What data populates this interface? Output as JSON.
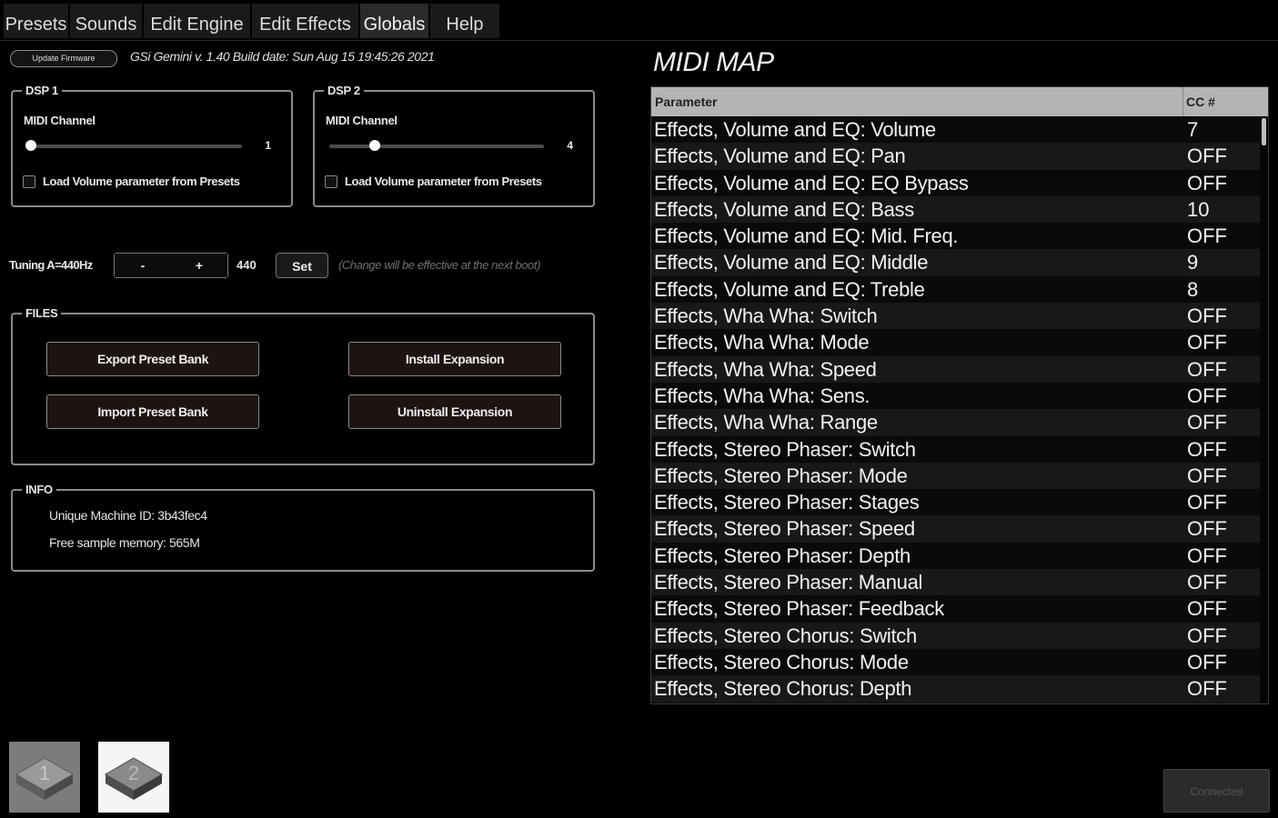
{
  "tabs": [
    {
      "label": "Presets",
      "active": false
    },
    {
      "label": "Sounds",
      "active": false
    },
    {
      "label": "Edit Engine",
      "active": false
    },
    {
      "label": "Edit Effects",
      "active": false
    },
    {
      "label": "Globals",
      "active": true
    },
    {
      "label": "Help",
      "active": false
    }
  ],
  "status": {
    "update_button": "Update Firmware",
    "build_info": "GSi Gemini v. 1.40 Build date: Sun Aug 15 19:45:26 2021"
  },
  "dsp1": {
    "title": "DSP 1",
    "midi_label": "MIDI Channel",
    "channel": "1",
    "channel_fraction": 0.0,
    "checkbox_label": "Load Volume parameter from Presets",
    "checked": false
  },
  "dsp2": {
    "title": "DSP 2",
    "midi_label": "MIDI Channel",
    "channel": "4",
    "channel_fraction": 0.2,
    "checkbox_label": "Load Volume parameter from Presets",
    "checked": false
  },
  "tuning": {
    "label": "Tuning A=440Hz",
    "minus": "-",
    "plus": "+",
    "value": "440",
    "set_label": "Set",
    "note": "(Change will be effective at the next boot)"
  },
  "files": {
    "title": "FILES",
    "export": "Export Preset Bank",
    "import": "Import Preset Bank",
    "install": "Install Expansion",
    "uninstall": "Uninstall Expansion"
  },
  "info": {
    "title": "INFO",
    "machine_id": "Unique Machine ID: 3b43fec4",
    "free_memory": "Free sample memory: 565M"
  },
  "midi_map": {
    "title": "MIDI MAP",
    "col_param": "Parameter",
    "col_cc": "CC #",
    "rows": [
      {
        "param": "Effects, Volume and EQ: Volume",
        "cc": "7"
      },
      {
        "param": "Effects, Volume and EQ: Pan",
        "cc": "OFF"
      },
      {
        "param": "Effects, Volume and EQ: EQ Bypass",
        "cc": "OFF"
      },
      {
        "param": "Effects, Volume and EQ: Bass",
        "cc": "10"
      },
      {
        "param": "Effects, Volume and EQ: Mid. Freq.",
        "cc": "OFF"
      },
      {
        "param": "Effects, Volume and EQ: Middle",
        "cc": "9"
      },
      {
        "param": "Effects, Volume and EQ: Treble",
        "cc": "8"
      },
      {
        "param": "Effects, Wha Wha: Switch",
        "cc": "OFF"
      },
      {
        "param": "Effects, Wha Wha: Mode",
        "cc": "OFF"
      },
      {
        "param": "Effects, Wha Wha: Speed",
        "cc": "OFF"
      },
      {
        "param": "Effects, Wha Wha: Sens.",
        "cc": "OFF"
      },
      {
        "param": "Effects, Wha Wha: Range",
        "cc": "OFF"
      },
      {
        "param": "Effects, Stereo Phaser: Switch",
        "cc": "OFF"
      },
      {
        "param": "Effects, Stereo Phaser: Mode",
        "cc": "OFF"
      },
      {
        "param": "Effects, Stereo Phaser: Stages",
        "cc": "OFF"
      },
      {
        "param": "Effects, Stereo Phaser: Speed",
        "cc": "OFF"
      },
      {
        "param": "Effects, Stereo Phaser: Depth",
        "cc": "OFF"
      },
      {
        "param": "Effects, Stereo Phaser: Manual",
        "cc": "OFF"
      },
      {
        "param": "Effects, Stereo Phaser: Feedback",
        "cc": "OFF"
      },
      {
        "param": "Effects, Stereo Chorus: Switch",
        "cc": "OFF"
      },
      {
        "param": "Effects, Stereo Chorus: Mode",
        "cc": "OFF"
      },
      {
        "param": "Effects, Stereo Chorus: Depth",
        "cc": "OFF"
      }
    ]
  },
  "dsp_selectors": [
    {
      "label": "1",
      "selected": false
    },
    {
      "label": "2",
      "selected": true
    }
  ],
  "connection": {
    "label": "Connected"
  }
}
